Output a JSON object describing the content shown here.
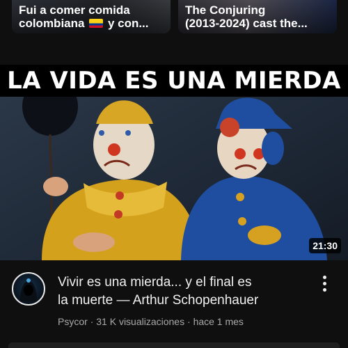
{
  "top_cards": [
    {
      "title_line1": "Fui a comer comida",
      "title_line2a": "colombiana",
      "title_line2b": "y con..."
    },
    {
      "title_line1": "The Conjuring",
      "title_line2": "(2013-2024) cast the..."
    }
  ],
  "video": {
    "thumbnail_text": "LA VIDA ES UNA MIERDA",
    "duration": "21:30",
    "title": "Vivir es una mierda... y el final es\nla muerte — Arthur Schopenhauer",
    "channel": "Psycor",
    "views": "31 K visualizaciones",
    "age": "hace 1 mes",
    "separator": "·"
  },
  "icons": {
    "more": "more-vertical-icon",
    "flag": "colombia-flag-icon"
  }
}
